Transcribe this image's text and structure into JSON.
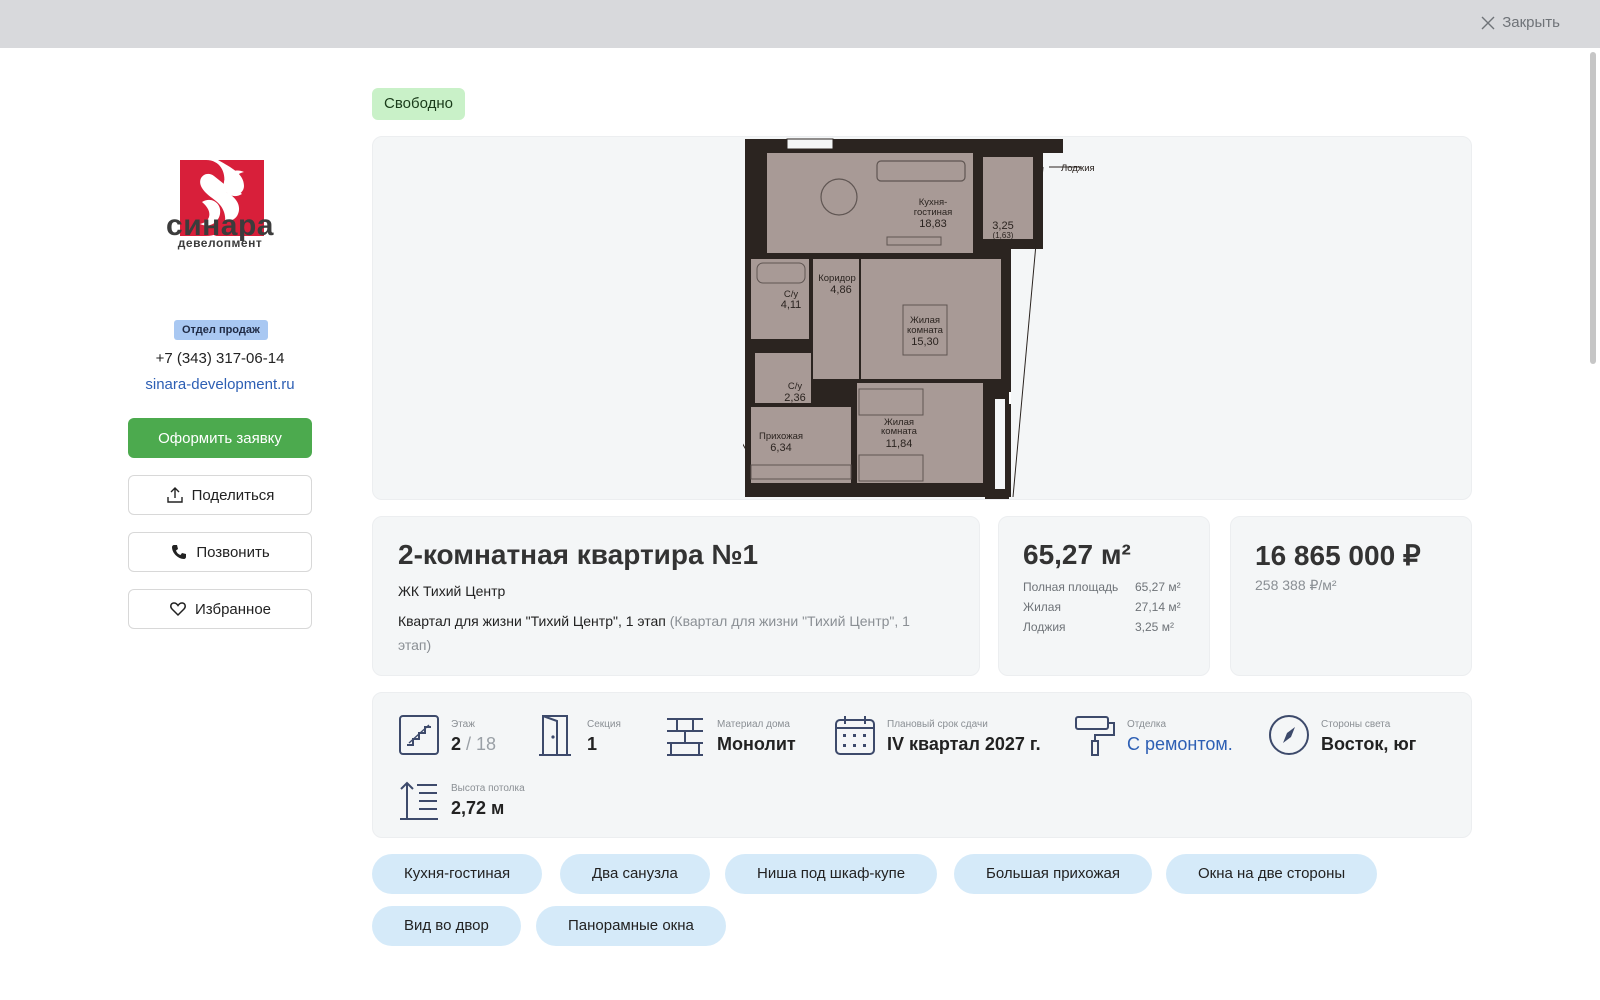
{
  "header": {
    "close_label": "Закрыть"
  },
  "brand": {
    "name": "синара",
    "subtitle": "девелопмент",
    "color": "#d81f3a"
  },
  "sidebar": {
    "dept_badge": "Отдел продаж",
    "phone": "+7 (343) 317-06-14",
    "site": "sinara-development.ru",
    "buttons": {
      "apply": "Оформить заявку",
      "share": "Поделиться",
      "call": "Позвонить",
      "favorite": "Избранное"
    }
  },
  "status": "Свободно",
  "plan": {
    "labels": {
      "loggia": "Лоджия",
      "kitchen": "Кухня-\nгостиная",
      "kitchen_area": "18,83",
      "loggia_area": "3,25",
      "loggia_area2": "(1,63)",
      "corridor": "Коридор",
      "corridor_area": "4,86",
      "bath1": "С/у",
      "bath1_area": "4,11",
      "living1": "Жилая\nкомната",
      "living1_area": "15,30",
      "bath2": "С/у",
      "bath2_area": "2,36",
      "hall": "Прихожая",
      "hall_area": "6,34",
      "living2": "Жилая\nкомната",
      "living2_area": "11,84"
    }
  },
  "apartment": {
    "title": "2-комнатная квартира №1",
    "complex": "ЖК Тихий Центр",
    "desc_main": "Квартал для жизни \"Тихий Центр\", 1 этап",
    "desc_muted": " (Квартал для жизни \"Тихий Центр\", 1 этап)"
  },
  "area": {
    "total": "65,27 м²",
    "rows": [
      {
        "k": "Полная площадь",
        "v": "65,27 м²"
      },
      {
        "k": "Жилая",
        "v": "27,14 м²"
      },
      {
        "k": "Лоджия",
        "v": "3,25 м²"
      }
    ]
  },
  "price": {
    "total": "16 865 000 ₽",
    "per_sqm": "258 388 ₽/м²"
  },
  "params": {
    "floor": {
      "label": "Этаж",
      "value": "2",
      "of": "/ 18"
    },
    "section": {
      "label": "Секция",
      "value": "1"
    },
    "material": {
      "label": "Материал дома",
      "value": "Монолит"
    },
    "deadline": {
      "label": "Плановый срок сдачи",
      "value": "IV квартал 2027 г."
    },
    "finish": {
      "label": "Отделка",
      "value": "С ремонтом."
    },
    "sides": {
      "label": "Стороны света",
      "value": "Восток, юг"
    },
    "ceiling": {
      "label": "Высота потолка",
      "value": "2,72 м"
    }
  },
  "tags": [
    "Кухня-гостиная",
    "Два санузла",
    "Ниша под шкаф-купе",
    "Большая прихожая",
    "Окна на две стороны",
    "Вид во двор",
    "Панорамные окна"
  ],
  "colors": {
    "accent_green": "#4caa4e",
    "link": "#2d5fb4",
    "tag_bg": "#d5eaf9",
    "status_bg": "#c9f1c8"
  }
}
